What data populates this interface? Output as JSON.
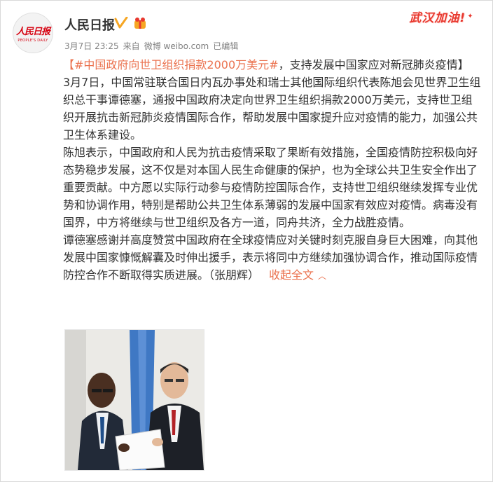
{
  "post": {
    "author": "人民日报",
    "avatar_text_cn": "人民日报",
    "avatar_text_en": "PEOPLE'S DAILY",
    "date": "3月7日 23:25",
    "source_prefix": "来自",
    "source": "微博 weibo.com",
    "edited": "已编辑",
    "hashtag_open": "【",
    "hashtag": "#中国政府向世卫组织捐款2000万美元#",
    "hashtag_close": "，支持发展中国家应对新冠肺炎疫情】",
    "para1": "3月7日，中国常驻联合国日内瓦办事处和瑞士其他国际组织代表陈旭会见世界卫生组织总干事谭德塞，通报中国政府决定向世界卫生组织捐款2000万美元，支持世卫组织开展抗击新冠肺炎疫情国际合作，帮助发展中国家提升应对疫情的能力，加强公共卫生体系建设。",
    "para2": "陈旭表示，中国政府和人民为抗击疫情采取了果断有效措施，全国疫情防控积极向好态势稳步发展，这不仅是对本国人民生命健康的保护，也为全球公共卫生安全作出了重要贡献。中方愿以实际行动参与疫情防控国际合作，支持世卫组织继续发挥专业优势和协调作用，特别是帮助公共卫生体系薄弱的发展中国家有效应对疫情。病毒没有国界，中方将继续与世卫组织及各方一道，同舟共济，全力战胜疫情。",
    "para3": "谭德塞感谢并高度赞赏中国政府在全球疫情应对关键时刻克服自身巨大困难，向其他发展中国家慷慨解囊及时伸出援手，表示将同中方继续加强协调合作，推动国际疫情防控合作不断取得实质进展。（张朋辉）",
    "collapse_label": "收起全文"
  },
  "sticker_text": "武汉加油!",
  "colors": {
    "link": "#eb7350",
    "meta": "#808080",
    "text": "#333333",
    "brand_red": "#d6000f",
    "verified": "#f6a623"
  },
  "icons": [
    "verified-icon",
    "vip-icon",
    "chevron-up-icon"
  ],
  "photo": {
    "description_icon": "photo"
  }
}
